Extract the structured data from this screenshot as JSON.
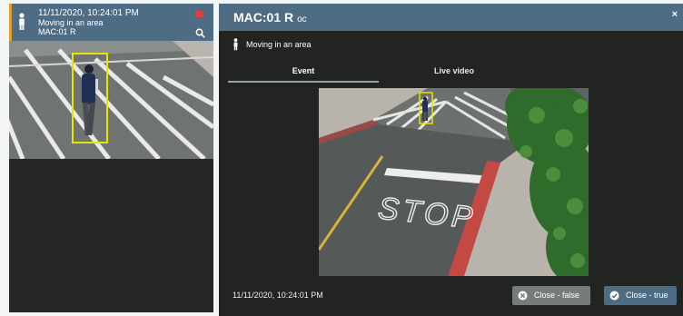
{
  "event_card": {
    "timestamp": "11/11/2020, 10:24:01 PM",
    "event_type": "Moving in an area",
    "camera": "MAC:01 R",
    "icons": [
      "person-icon",
      "flag-icon",
      "search-icon"
    ]
  },
  "modal": {
    "title": "MAC:01 R",
    "title_suffix": "oc",
    "close_label": "×",
    "event_type": "Moving in an area",
    "tabs": [
      {
        "label": "Event",
        "active": true
      },
      {
        "label": "Live video",
        "active": false
      }
    ],
    "video_text": "STOP",
    "footer_time": "11/11/2020, 10:24:01 PM",
    "buttons": {
      "close_false": "Close - false",
      "close_true": "Close - true"
    }
  },
  "colors": {
    "header": "#4e6d84",
    "panel": "#252725",
    "accent": "#e0a030",
    "detection_box": "#e6e600",
    "flag": "#e04040"
  }
}
